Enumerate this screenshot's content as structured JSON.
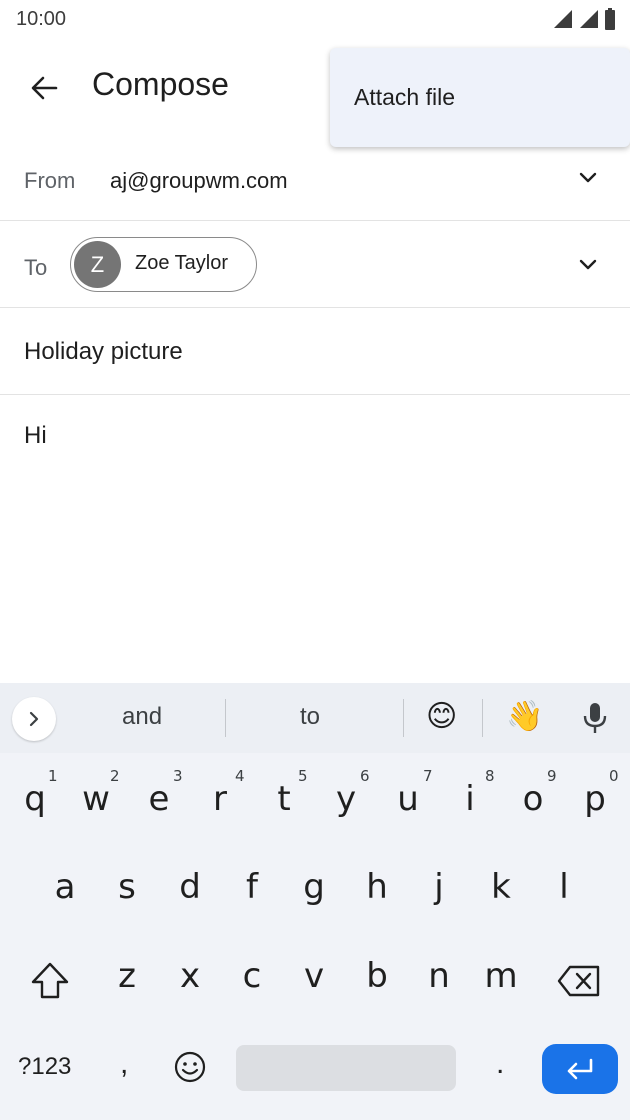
{
  "status_bar": {
    "time": "10:00",
    "icons": [
      "wifi-icon",
      "signal-icon",
      "battery-icon"
    ]
  },
  "app_bar": {
    "back_icon": "arrow-left-icon",
    "title": "Compose"
  },
  "overflow_menu": {
    "items": [
      {
        "label": "Attach file"
      }
    ]
  },
  "compose": {
    "from_label": "From",
    "from_value": "aj@groupwm.com",
    "to_label": "To",
    "recipient": {
      "initial": "Z",
      "name": "Zoe Taylor"
    },
    "subject": "Holiday picture",
    "body": "Hi"
  },
  "keyboard": {
    "suggestions": [
      "and",
      "to"
    ],
    "emoji_suggestions": [
      "😊",
      "👋"
    ],
    "row1": [
      {
        "key": "q",
        "hint": "1"
      },
      {
        "key": "w",
        "hint": "2"
      },
      {
        "key": "e",
        "hint": "3"
      },
      {
        "key": "r",
        "hint": "4"
      },
      {
        "key": "t",
        "hint": "5"
      },
      {
        "key": "y",
        "hint": "6"
      },
      {
        "key": "u",
        "hint": "7"
      },
      {
        "key": "i",
        "hint": "8"
      },
      {
        "key": "o",
        "hint": "9"
      },
      {
        "key": "p",
        "hint": "0"
      }
    ],
    "row2": [
      "a",
      "s",
      "d",
      "f",
      "g",
      "h",
      "j",
      "k",
      "l"
    ],
    "row3": [
      "z",
      "x",
      "c",
      "v",
      "b",
      "n",
      "m"
    ],
    "symbols_label": "?123",
    "comma_label": ",",
    "period_label": ".",
    "accent_color": "#1a73e8"
  }
}
